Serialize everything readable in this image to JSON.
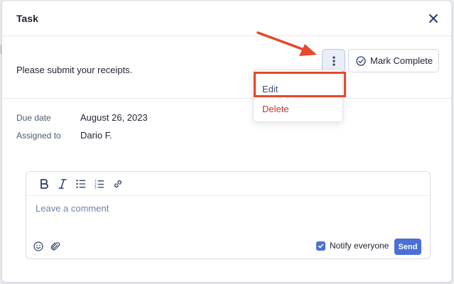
{
  "modal": {
    "title": "Task",
    "task_text": "Please submit your receipts.",
    "mark_complete_label": "Mark Complete",
    "menu": {
      "edit_label": "Edit",
      "delete_label": "Delete"
    },
    "details": {
      "due_label": "Due date",
      "due_value": "August 26, 2023",
      "assigned_label": "Assigned to",
      "assigned_value": "Dario F."
    },
    "comment": {
      "placeholder": "Leave a comment",
      "notify_label": "Notify everyone",
      "notify_checked": true,
      "send_label": "Send"
    }
  },
  "colors": {
    "accent": "#4a6fd6",
    "delete": "#c0392b",
    "highlight": "#e8472b"
  }
}
